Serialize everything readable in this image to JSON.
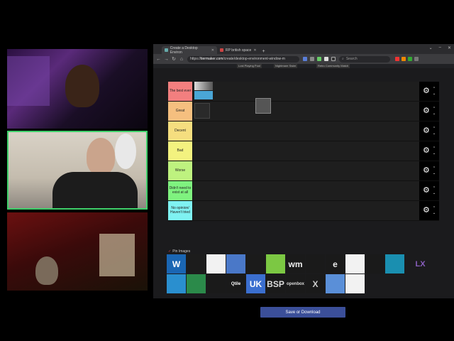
{
  "browser": {
    "tabs": [
      {
        "label": "Create a Desktop Environ",
        "active": true
      },
      {
        "label": "RP british space",
        "active": false
      }
    ],
    "new_tab": "+",
    "window_controls": [
      "⌄",
      "–",
      "✕"
    ],
    "url_scheme": "https://",
    "url_host": "tiermaker.com",
    "url_path": "/create/desktop-environment-window-m",
    "search_placeholder": "Search",
    "bookmarks": [
      "Lost Playing Pool",
      "Nightmare Swim",
      "Retro Community Match"
    ]
  },
  "tiers": [
    {
      "label": "The best ever",
      "color": "#f27f7f"
    },
    {
      "label": "Great",
      "color": "#f5bf7f"
    },
    {
      "label": "Decent",
      "color": "#f5de7f"
    },
    {
      "label": "Bad",
      "color": "#f3f27f"
    },
    {
      "label": "Worse",
      "color": "#bef27f"
    },
    {
      "label": "Didn't need to exist at all",
      "color": "#7ff27f"
    },
    {
      "label": "No opinion/ Haven't tried",
      "color": "#7ff2f2"
    }
  ],
  "pool_title": "Pin Images",
  "pool_items": [
    {
      "icon": "wayfire-logo-icon",
      "text": "W"
    },
    {
      "icon": "orange-mountain-logo-icon",
      "text": ""
    },
    {
      "icon": "kde-plasma-logo-icon",
      "text": ""
    },
    {
      "icon": "blue-u-logo-icon",
      "text": ""
    },
    {
      "icon": "white-x-logo-icon",
      "text": ""
    },
    {
      "icon": "green-spiral-logo-icon",
      "text": ""
    },
    {
      "icon": "wm-logo-icon",
      "text": "wm"
    },
    {
      "icon": "grey-swoosh-logo-icon",
      "text": ""
    },
    {
      "icon": "e-logo-icon",
      "text": "e"
    },
    {
      "icon": "sail-logo-icon",
      "text": ""
    },
    {
      "icon": "dots-logo-icon",
      "text": ""
    },
    {
      "icon": "magnifier-logo-icon",
      "text": ""
    },
    {
      "icon": "lxqt-logo-icon",
      "text": "LX"
    },
    {
      "icon": "deepin-logo-icon",
      "text": ""
    },
    {
      "icon": "budgie-logo-icon",
      "text": ""
    },
    {
      "icon": "ubuntu-logo-icon",
      "text": ""
    },
    {
      "icon": "qtile-logo-icon",
      "text": "Qtile"
    },
    {
      "icon": "unity-logo-icon",
      "text": "UK"
    },
    {
      "icon": "bspwm-logo-icon",
      "text": "BSP"
    },
    {
      "icon": "openbox-logo-icon",
      "text": "openbox"
    },
    {
      "icon": "x-logo-icon",
      "text": "X"
    },
    {
      "icon": "blue-sail-logo-icon",
      "text": ""
    },
    {
      "icon": "sail-white-logo-icon",
      "text": ""
    }
  ],
  "save_button": "Save or Download"
}
